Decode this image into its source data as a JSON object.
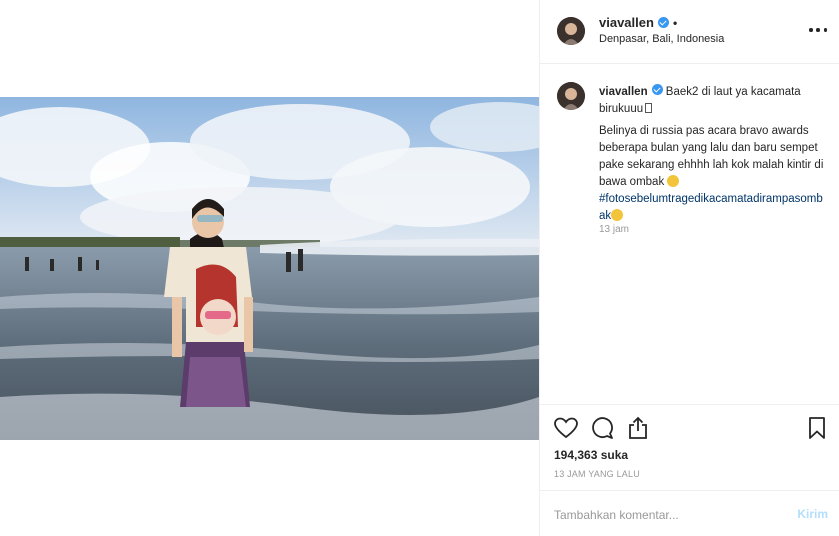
{
  "post": {
    "username": "viavallen",
    "location": "Denpasar, Bali, Indonesia",
    "separator": "•",
    "caption": {
      "line1": "Baek2 di laut ya kacamata birukuuu",
      "line2": "Belinya di russia pas acara bravo awards beberapa bulan yang lalu dan baru sempet pake sekarang ehhhh lah kok malah kintir di bawa ombak",
      "hashtag": "#fotosebelumtragedikacamatadirampasombak"
    },
    "caption_time": "13 jam",
    "likes": "194,363 suka",
    "time_ago": "13 JAM YANG LALU"
  },
  "comment": {
    "placeholder": "Tambahkan komentar...",
    "post_label": "Kirim"
  },
  "icons": {
    "more": "more-options-icon",
    "like": "heart-icon",
    "comment": "comment-bubble-icon",
    "share": "share-icon",
    "save": "bookmark-icon",
    "verified": "verified-badge-icon"
  },
  "colors": {
    "verified": "#3897f0",
    "hashtag": "#003569",
    "muted": "#999999",
    "post_button": "#b2dffc"
  }
}
